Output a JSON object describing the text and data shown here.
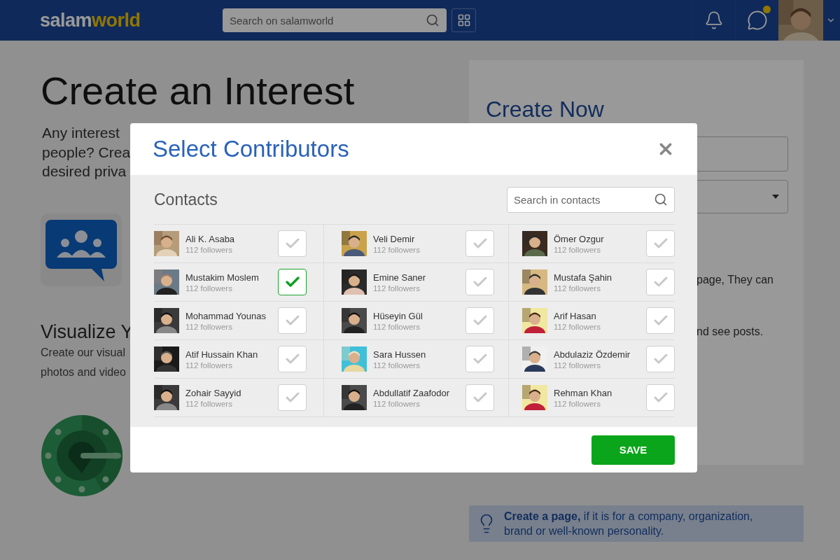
{
  "header": {
    "logo": {
      "first": "salam",
      "second": "world"
    },
    "search": {
      "placeholder": "Search on salamworld"
    },
    "messages_unread": true
  },
  "page": {
    "title": "Create an Interest",
    "intro_lines": [
      "Any interest",
      "people? Crea",
      "desired priva"
    ],
    "visualize": {
      "title": "Visualize Y",
      "lines": [
        "Create our visual",
        "photos and video"
      ]
    }
  },
  "create_now": {
    "title": "Create Now",
    "fragments": [
      "page, They can",
      "nd see posts."
    ]
  },
  "tip": {
    "text": "**Create a page,** if it is for a company, organization, brand or well-known personality."
  },
  "modal": {
    "title": "Select Contributors",
    "section": "Contacts",
    "search": {
      "placeholder": "Search in contacts"
    },
    "contacts": [
      {
        "name": "Ali K. Asaba",
        "followers": "112 followers",
        "checked": false
      },
      {
        "name": "Veli Demir",
        "followers": "112 followers",
        "checked": false
      },
      {
        "name": "Ömer Ozgur",
        "followers": "112 followers",
        "checked": false
      },
      {
        "name": "Mustakim Moslem",
        "followers": "112 followers",
        "checked": true
      },
      {
        "name": "Emine Saner",
        "followers": "112 followers",
        "checked": false
      },
      {
        "name": "Mustafa Şahin",
        "followers": "112 followers",
        "checked": false
      },
      {
        "name": "Mohammad Younas",
        "followers": "112 followers",
        "checked": false
      },
      {
        "name": "Hüseyin Gül",
        "followers": "112 followers",
        "checked": false
      },
      {
        "name": "Arif Hasan",
        "followers": "112 followers",
        "checked": false
      },
      {
        "name": "Atif Hussain Khan",
        "followers": "112 followers",
        "checked": false
      },
      {
        "name": "Sara Hussen",
        "followers": "112 followers",
        "checked": false
      },
      {
        "name": "Abdulaziz Özdemir",
        "followers": "112 followers",
        "checked": false
      },
      {
        "name": "Zohair Sayyid",
        "followers": "112 followers",
        "checked": false
      },
      {
        "name": "Abdullatif Zaafodor",
        "followers": "112 followers",
        "checked": false
      },
      {
        "name": "Rehman Khan",
        "followers": "112 followers",
        "checked": false
      }
    ],
    "save": "SAVE"
  }
}
